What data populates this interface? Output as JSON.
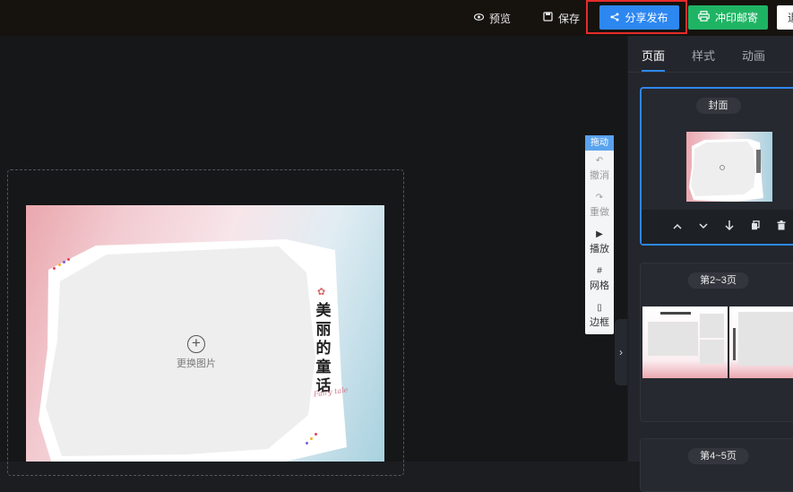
{
  "topbar": {
    "preview_label": "预览",
    "save_label": "保存",
    "share_label": "分享发布",
    "print_label": "冲印邮寄",
    "exit_label": "退"
  },
  "canvas": {
    "change_image_label": "更换图片",
    "title_vertical": "美\n丽\n的\n童\n话",
    "script_text": "Fairy tale"
  },
  "tools": {
    "drag_label": "拖动",
    "undo_label": "撤消",
    "redo_label": "重做",
    "play_label": "播放",
    "grid_label": "网格",
    "border_label": "边框"
  },
  "panel": {
    "tabs": [
      "页面",
      "样式",
      "动画"
    ],
    "active_tab": "页面",
    "cards": [
      {
        "label": "封面"
      },
      {
        "label": "第2~3页"
      },
      {
        "label": "第4~5页"
      }
    ]
  },
  "colors": {
    "accent": "#2d87f0",
    "print_green": "#1fb464",
    "highlight_red": "#e52b2b"
  }
}
